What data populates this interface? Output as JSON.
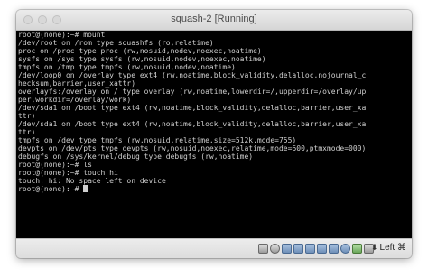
{
  "window": {
    "title": "squash-2 [Running]"
  },
  "terminal": {
    "lines": [
      "root@(none):~# mount",
      "/dev/root on /rom type squashfs (ro,relatime)",
      "proc on /proc type proc (rw,nosuid,nodev,noexec,noatime)",
      "sysfs on /sys type sysfs (rw,nosuid,nodev,noexec,noatime)",
      "tmpfs on /tmp type tmpfs (rw,nosuid,nodev,noatime)",
      "/dev/loop0 on /overlay type ext4 (rw,noatime,block_validity,delalloc,nojournal_c",
      "hecksum,barrier,user_xattr)",
      "overlayfs:/overlay on / type overlay (rw,noatime,lowerdir=/,upperdir=/overlay/up",
      "per,workdir=/overlay/work)",
      "/dev/sda1 on /boot type ext4 (rw,noatime,block_validity,delalloc,barrier,user_xa",
      "ttr)",
      "/dev/sda1 on /boot type ext4 (rw,noatime,block_validity,delalloc,barrier,user_xa",
      "ttr)",
      "tmpfs on /dev type tmpfs (rw,nosuid,relatime,size=512k,mode=755)",
      "devpts on /dev/pts type devpts (rw,nosuid,noexec,relatime,mode=600,ptmxmode=000)",
      "debugfs on /sys/kernel/debug type debugfs (rw,noatime)",
      "root@(none):~# ls",
      "root@(none):~# touch hi",
      "touch: hi: No space left on device",
      "root@(none):~# "
    ]
  },
  "statusbar": {
    "host_key_label": "Left ⌘",
    "icons": [
      "hard-disk-icon",
      "optical-disk-icon",
      "audio-icon",
      "network-icon",
      "usb-icon",
      "shared-folders-icon",
      "display-icon",
      "video-capture-icon",
      "cpu-icon",
      "mouse-integration-icon"
    ]
  }
}
